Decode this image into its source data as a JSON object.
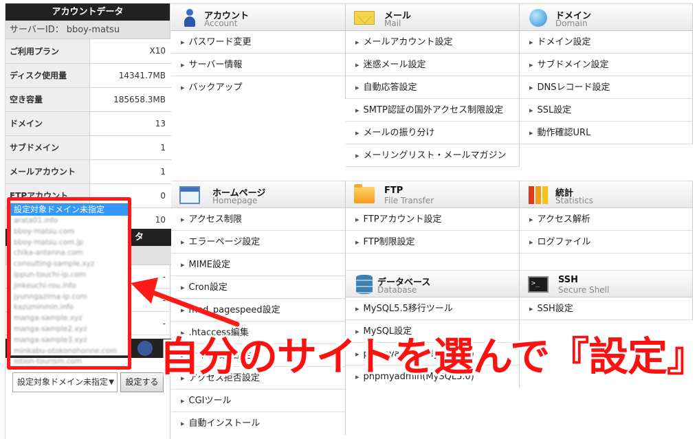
{
  "account": {
    "title": "アカウントデータ",
    "server_label": "サーバーID：",
    "server_id": "bboy-matsu",
    "stats": [
      {
        "label": "ご利用プラン",
        "value": "X10"
      },
      {
        "label": "ディスク使用量",
        "value": "14341.7MB"
      },
      {
        "label": "空き容量",
        "value": "185658.3MB"
      },
      {
        "label": "ドメイン",
        "value": "13"
      },
      {
        "label": "サブドメイン",
        "value": "1"
      },
      {
        "label": "メールアカウント",
        "value": "1"
      },
      {
        "label": "FTPアカウント",
        "value": "0"
      }
    ],
    "hidden_value": "10",
    "second_title_fragment": "タ",
    "row_values": [
      "-",
      "-",
      "-"
    ]
  },
  "domain_select": {
    "selected": "設定対象ドメイン未指定",
    "options": [
      "設定対象ドメイン未指定",
      "arata01.info",
      "bboy-matsu.com",
      "bboy-matsu.com.jp",
      "chika-antenna.com",
      "consulting-sample.xyz",
      "ippun-touchi-ip.com",
      "jinkeuchi-rou.info",
      "jyunngazirna-ip.com",
      "kazuminmin.info",
      "manga-sample.xyz",
      "manga-sample2.xyz",
      "manga-sample3.xyz",
      "minkabu-otokonohonne.com",
      "lotion-tourism.com"
    ],
    "button": "設定する",
    "arrow": "▼"
  },
  "sections": {
    "account": {
      "title": "アカウント",
      "en": "Account",
      "items": [
        "パスワード変更",
        "サーバー情報",
        "バックアップ"
      ]
    },
    "mail": {
      "title": "メール",
      "en": "Mail",
      "items": [
        "メールアカウント設定",
        "迷惑メール設定",
        "自動応答設定",
        "SMTP認証の国外アクセス制限設定",
        "メールの振り分け",
        "メーリングリスト・メールマガジン"
      ]
    },
    "domain": {
      "title": "ドメイン",
      "en": "Domain",
      "items": [
        "ドメイン設定",
        "サブドメイン設定",
        "DNSレコード設定",
        "SSL設定",
        "動作確認URL"
      ]
    },
    "homepage": {
      "title": "ホームページ",
      "en": "Homepage",
      "items": [
        "アクセス制限",
        "エラーページ設定",
        "MIME設定",
        "Cron設定",
        "mod_pagespeed設定",
        ".htaccess編集",
        "サイト転送設定",
        "アクセス拒否設定",
        "CGIツール",
        "自動インストール"
      ]
    },
    "ftp": {
      "title": "FTP",
      "en": "File Transfer",
      "items": [
        "FTPアカウント設定",
        "FTP制限設定"
      ]
    },
    "stats": {
      "title": "統計",
      "en": "Statistics",
      "items": [
        "アクセス解析",
        "ログファイル"
      ]
    },
    "database": {
      "title": "データベース",
      "en": "Database",
      "items": [
        "MySQL5.5移行ツール",
        "MySQL設定",
        "phpmyadmin(MySQL5.5)",
        "phpmyadmin(MySQL5.0)"
      ]
    },
    "ssh": {
      "title": "SSH",
      "en": "Secure Shell",
      "items": [
        "SSH設定"
      ]
    }
  },
  "annotation": {
    "text": "自分のサイトを選んで『設定』",
    "color": "#ff1010"
  }
}
